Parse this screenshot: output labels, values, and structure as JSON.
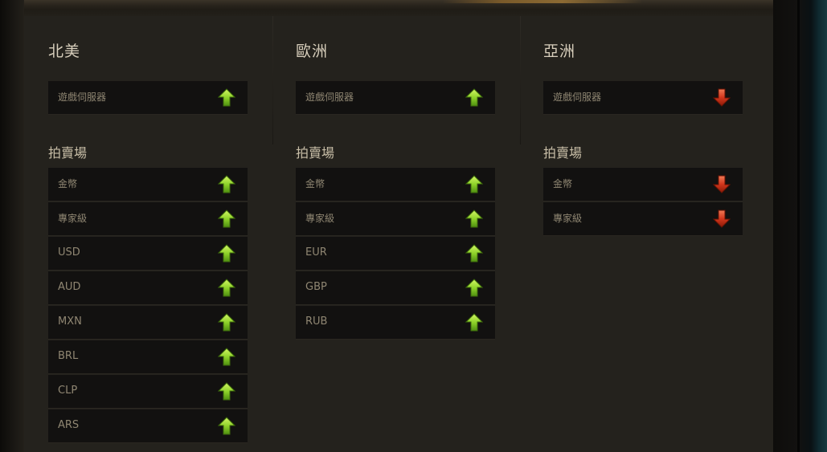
{
  "columns": [
    {
      "region": "北美",
      "server": {
        "label": "遊戲伺服器",
        "status": "up"
      },
      "auction_title": "拍賣場",
      "auction_items": [
        {
          "label": "金幣",
          "status": "up"
        },
        {
          "label": "專家級",
          "status": "up"
        },
        {
          "label": "USD",
          "status": "up"
        },
        {
          "label": "AUD",
          "status": "up"
        },
        {
          "label": "MXN",
          "status": "up"
        },
        {
          "label": "BRL",
          "status": "up"
        },
        {
          "label": "CLP",
          "status": "up"
        },
        {
          "label": "ARS",
          "status": "up"
        }
      ]
    },
    {
      "region": "歐洲",
      "server": {
        "label": "遊戲伺服器",
        "status": "up"
      },
      "auction_title": "拍賣場",
      "auction_items": [
        {
          "label": "金幣",
          "status": "up"
        },
        {
          "label": "專家級",
          "status": "up"
        },
        {
          "label": "EUR",
          "status": "up"
        },
        {
          "label": "GBP",
          "status": "up"
        },
        {
          "label": "RUB",
          "status": "up"
        }
      ]
    },
    {
      "region": "亞洲",
      "server": {
        "label": "遊戲伺服器",
        "status": "down"
      },
      "auction_title": "拍賣場",
      "auction_items": [
        {
          "label": "金幣",
          "status": "down"
        },
        {
          "label": "專家級",
          "status": "down"
        }
      ]
    }
  ],
  "colors": {
    "up": "#8fd32a",
    "down": "#d2361c"
  },
  "icons": {
    "up": "arrow-up-icon",
    "down": "arrow-down-icon"
  }
}
